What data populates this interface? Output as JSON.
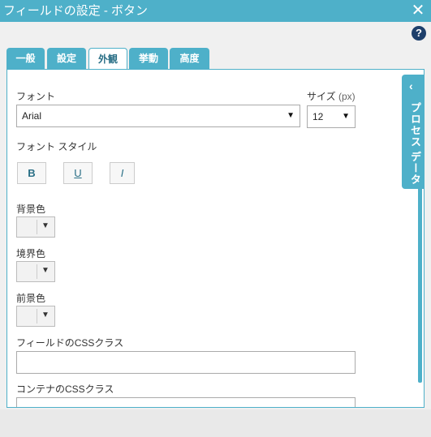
{
  "window": {
    "title": "フィールドの設定 - ボタン",
    "close_glyph": "✕"
  },
  "help_glyph": "?",
  "tabs": [
    {
      "label": "一般"
    },
    {
      "label": "設定"
    },
    {
      "label": "外観",
      "active": true
    },
    {
      "label": "挙動"
    },
    {
      "label": "高度"
    }
  ],
  "font": {
    "label": "フォント",
    "value": "Arial"
  },
  "size": {
    "label": "サイズ",
    "unit": "(px)",
    "value": "12"
  },
  "font_style": {
    "label": "フォント スタイル",
    "bold": "B",
    "underline": "U",
    "italic": "I"
  },
  "background_color": {
    "label": "背景色"
  },
  "border_color": {
    "label": "境界色"
  },
  "foreground_color": {
    "label": "前景色"
  },
  "field_css": {
    "label": "フィールドのCSSクラス",
    "value": ""
  },
  "container_css": {
    "label": "コンテナのCSSクラス",
    "value": ""
  },
  "side_panel": {
    "label": "プロセス データ",
    "chevron": "‹"
  },
  "colors": {
    "accent": "#4eb0c9",
    "help": "#1e3f6b"
  }
}
